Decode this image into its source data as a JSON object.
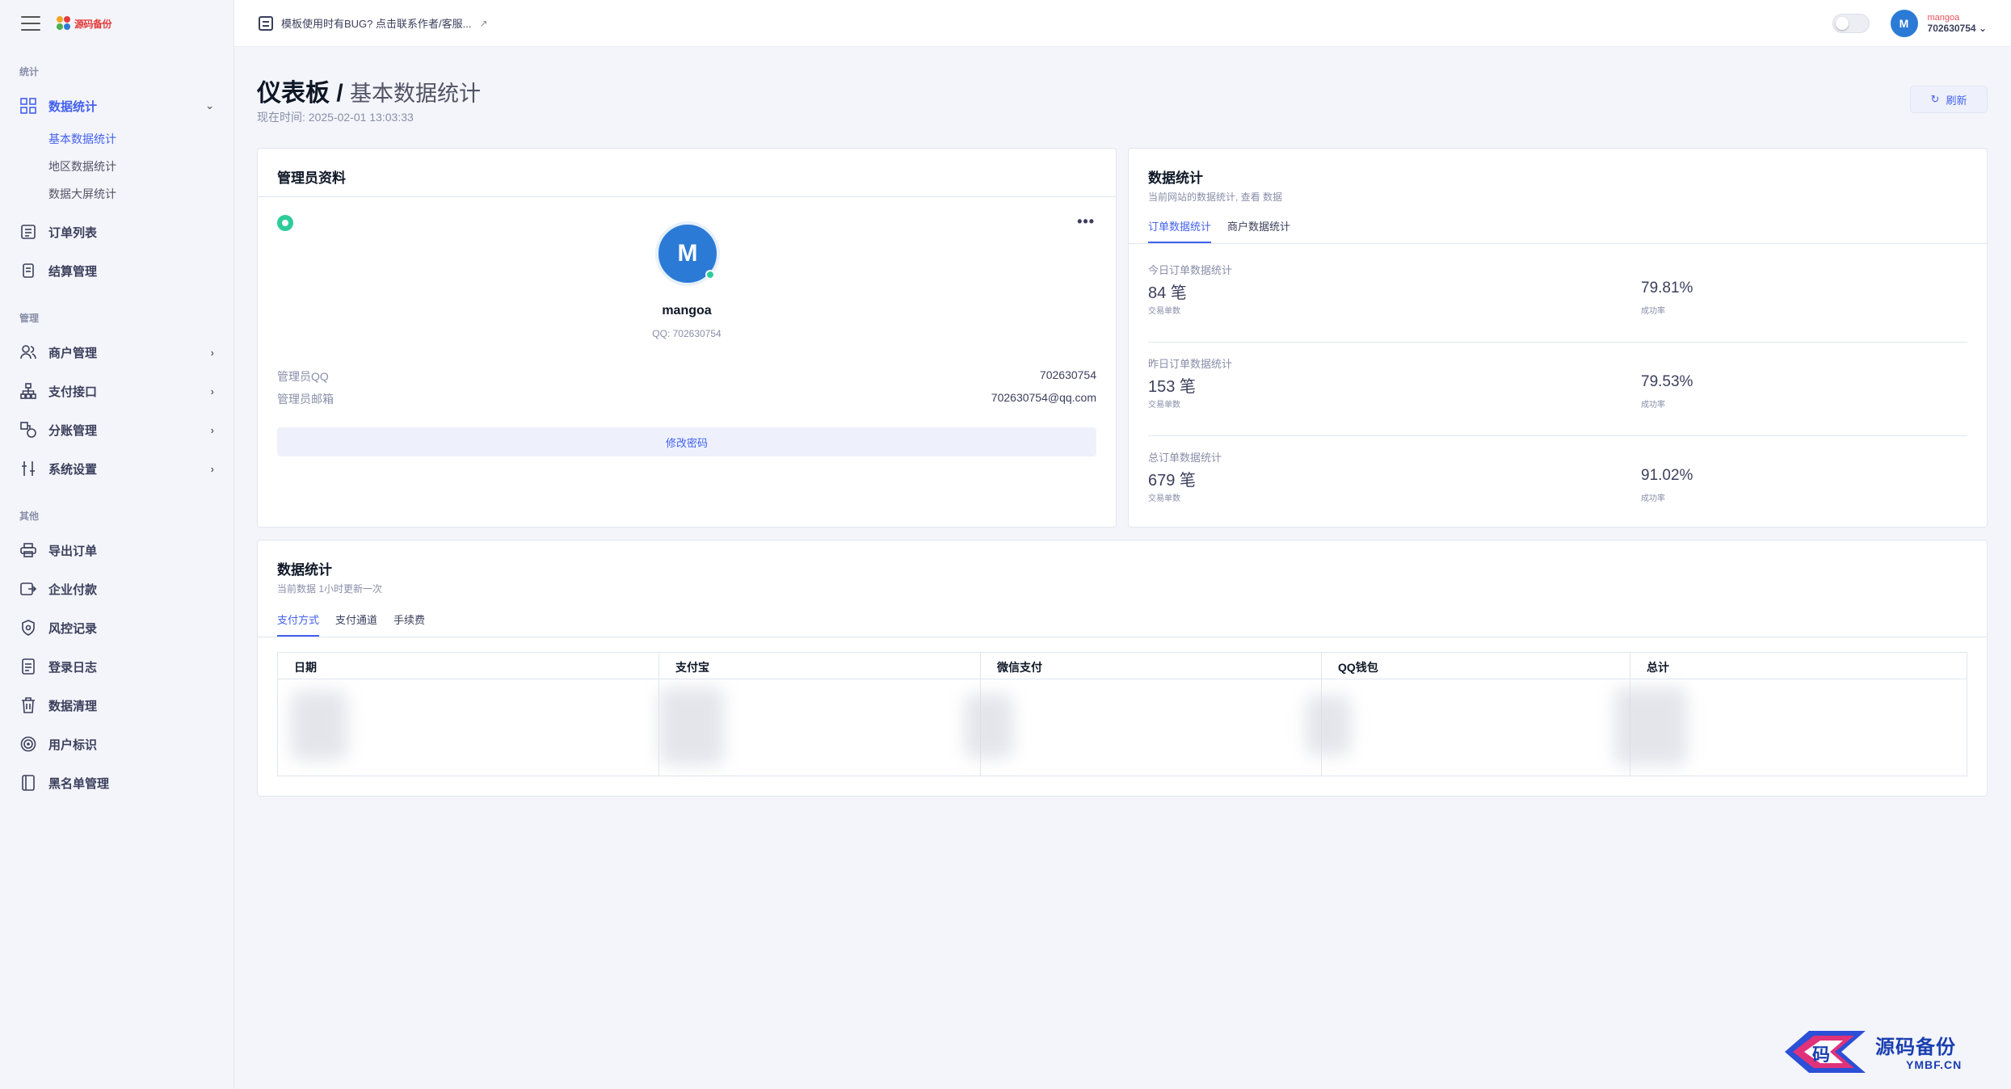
{
  "sidebar": {
    "logo_text": "源码备份",
    "sections": {
      "stats": "统计",
      "manage": "管理",
      "other": "其他"
    },
    "items": {
      "data_stats": "数据统计",
      "basic_stats": "基本数据统计",
      "region_stats": "地区数据统计",
      "bigscreen_stats": "数据大屏统计",
      "order_list": "订单列表",
      "settlement": "结算管理",
      "merchant": "商户管理",
      "payment_api": "支付接口",
      "split": "分账管理",
      "system": "系统设置",
      "export_order": "导出订单",
      "enterprise_pay": "企业付款",
      "risk": "风控记录",
      "login_log": "登录日志",
      "data_clean": "数据清理",
      "user_tag": "用户标识",
      "blacklist": "黑名单管理"
    }
  },
  "topbar": {
    "notice": "模板使用时有BUG? 点击联系作者/客服...",
    "user_name": "mangoa",
    "user_id": "702630754"
  },
  "page": {
    "title_main": "仪表板 /",
    "title_sub": "基本数据统计",
    "time": "现在时间: 2025-02-01 13:03:33",
    "refresh": "刷新"
  },
  "admin": {
    "title": "管理员资料",
    "name": "mangoa",
    "qq_line": "QQ: 702630754",
    "qq_label": "管理员QQ",
    "qq_value": "702630754",
    "email_label": "管理员邮箱",
    "email_value": "702630754@qq.com",
    "change_pw": "修改密码"
  },
  "stats": {
    "title": "数据统计",
    "desc": "当前网站的数据统计, 查看 数据",
    "tabs": [
      "订单数据统计",
      "商户数据统计"
    ],
    "blocks": [
      {
        "label": "今日订单数据统计",
        "count": "84 笔",
        "count_sub": "交易单数",
        "rate": "79.81%",
        "rate_sub": "成功率"
      },
      {
        "label": "昨日订单数据统计",
        "count": "153 笔",
        "count_sub": "交易单数",
        "rate": "79.53%",
        "rate_sub": "成功率"
      },
      {
        "label": "总订单数据统计",
        "count": "679 笔",
        "count_sub": "交易单数",
        "rate": "91.02%",
        "rate_sub": "成功率"
      }
    ]
  },
  "data_table": {
    "title": "数据统计",
    "desc": "当前数据 1小时更新一次",
    "tabs": [
      "支付方式",
      "支付通道",
      "手续费"
    ],
    "columns": [
      "日期",
      "支付宝",
      "微信支付",
      "QQ钱包",
      "总计"
    ]
  },
  "watermark": {
    "text": "源码备份",
    "sub": "YMBF.CN",
    "glyph": "码"
  }
}
